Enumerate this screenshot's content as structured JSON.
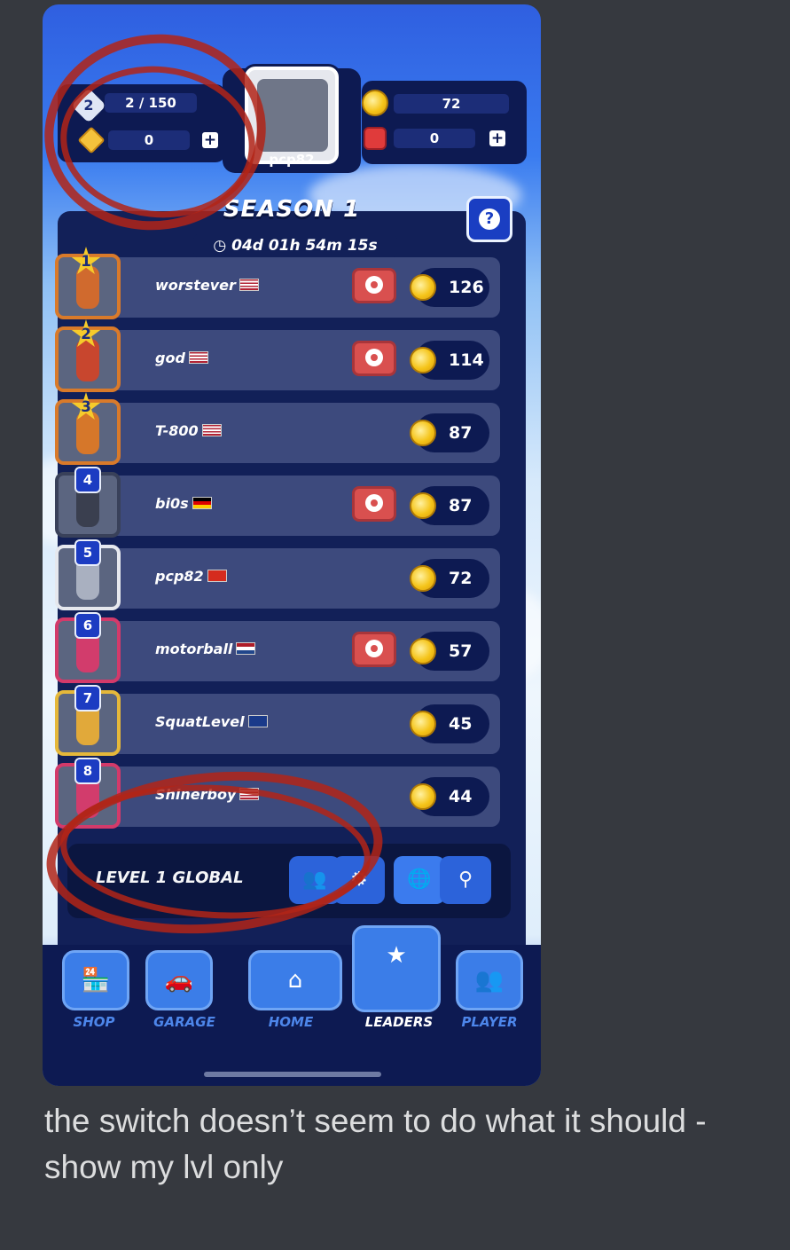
{
  "hud": {
    "level": "2",
    "xp": "2 / 150",
    "gems": "0",
    "coins": "72",
    "rubies": "0",
    "player_name": "pcp82"
  },
  "season": {
    "title": "SEASON 1",
    "timer": "04d 01h 54m 15s",
    "help_icon": "?"
  },
  "leaderboard": [
    {
      "rank": "1",
      "name": "worstever",
      "flag": "us",
      "score": "126",
      "watch": true,
      "rank_style": "star",
      "frame": "#d97a2a",
      "car": "#d06a2e"
    },
    {
      "rank": "2",
      "name": "god",
      "flag": "us",
      "score": "114",
      "watch": true,
      "rank_style": "star",
      "frame": "#d97a2a",
      "car": "#c8462e"
    },
    {
      "rank": "3",
      "name": "T-800",
      "flag": "us",
      "score": "87",
      "watch": false,
      "rank_style": "star",
      "frame": "#d97a2a",
      "car": "#d6772a"
    },
    {
      "rank": "4",
      "name": "bi0s",
      "flag": "de",
      "score": "87",
      "watch": true,
      "rank_style": "box",
      "frame": "#39415a",
      "car": "#3a3f4f"
    },
    {
      "rank": "5",
      "name": "pcp82",
      "flag": "ch",
      "score": "72",
      "watch": false,
      "rank_style": "box",
      "frame": "#e6e8ee",
      "car": "#a9b0c0"
    },
    {
      "rank": "6",
      "name": "motorball",
      "flag": "nl",
      "score": "57",
      "watch": true,
      "rank_style": "box",
      "frame": "#d33a6a",
      "car": "#d23c6c"
    },
    {
      "rank": "7",
      "name": "SquatLevel",
      "flag": "gb",
      "score": "45",
      "watch": false,
      "rank_style": "box",
      "frame": "#e5b83a",
      "car": "#e1a93a"
    },
    {
      "rank": "8",
      "name": "Shinerboy",
      "flag": "us",
      "score": "44",
      "watch": false,
      "rank_style": "box",
      "frame": "#d33a6a",
      "car": "#d23c6c"
    }
  ],
  "filter": {
    "label": "LEVEL 1 GLOBAL",
    "buttons": [
      "friends-icon",
      "car-icon",
      "globe-icon",
      "location-pin-icon"
    ],
    "active": "globe-icon"
  },
  "nav": {
    "items": [
      "SHOP",
      "GARAGE",
      "HOME",
      "LEADERS",
      "PLAYER"
    ],
    "selected": "LEADERS"
  },
  "caption": "the switch doesn’t seem to do what it should - show my lvl only",
  "colors": {
    "panel": "#122058",
    "row": "#3d4a7d",
    "annotation_red": "#b22418",
    "discord_bg": "#36393f"
  }
}
